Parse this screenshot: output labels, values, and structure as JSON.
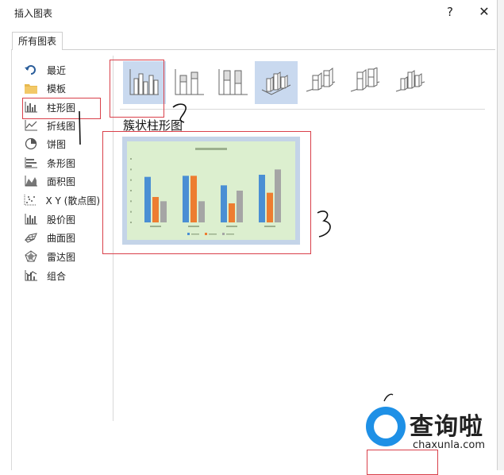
{
  "window": {
    "title": "插入图表",
    "help_label": "?",
    "close_label": "✕"
  },
  "tabs": [
    {
      "label": "所有图表",
      "selected": true
    }
  ],
  "sidebar": {
    "items": [
      {
        "label": "最近",
        "icon": "undo-arrow-icon"
      },
      {
        "label": "模板",
        "icon": "folder-icon"
      },
      {
        "label": "柱形图",
        "icon": "column-chart-icon",
        "selected": true
      },
      {
        "label": "折线图",
        "icon": "line-chart-icon"
      },
      {
        "label": "饼图",
        "icon": "pie-chart-icon"
      },
      {
        "label": "条形图",
        "icon": "bar-chart-icon"
      },
      {
        "label": "面积图",
        "icon": "area-chart-icon"
      },
      {
        "label": "X Y (散点图)",
        "icon": "scatter-chart-icon"
      },
      {
        "label": "股价图",
        "icon": "stock-chart-icon"
      },
      {
        "label": "曲面图",
        "icon": "surface-chart-icon"
      },
      {
        "label": "雷达图",
        "icon": "radar-chart-icon"
      },
      {
        "label": "组合",
        "icon": "combo-chart-icon"
      }
    ]
  },
  "subtypes": [
    {
      "icon": "clustered-column-icon",
      "selected": true
    },
    {
      "icon": "stacked-column-icon"
    },
    {
      "icon": "100-stacked-column-icon"
    },
    {
      "icon": "3d-clustered-column-icon",
      "highlighted": true
    },
    {
      "icon": "3d-stacked-column-icon"
    },
    {
      "icon": "3d-100-stacked-column-icon"
    },
    {
      "icon": "3d-column-icon"
    }
  ],
  "main": {
    "chart_heading": "簇状柱形图"
  },
  "watermark": {
    "brand": "查询啦",
    "url": "chaxunla.com"
  },
  "colors": {
    "accent": "#c9d9ef",
    "annotation": "#d9404a",
    "series1": "#4a8fd4",
    "series2": "#ed7d31",
    "series3": "#a5a5a5",
    "preview_bg": "#dcefcf",
    "watermark_blue": "#1e90e6"
  },
  "chart_data": {
    "type": "bar",
    "categories": [
      "",
      "",
      "",
      ""
    ],
    "series": [
      {
        "values": [
          4.3,
          4.4,
          3.5,
          4.5
        ]
      },
      {
        "values": [
          2.4,
          4.4,
          1.8,
          2.8
        ]
      },
      {
        "values": [
          2.0,
          2.0,
          3.0,
          5.0
        ]
      }
    ],
    "ylim": [
      0,
      6
    ],
    "grid": false,
    "legend": "bottom"
  }
}
